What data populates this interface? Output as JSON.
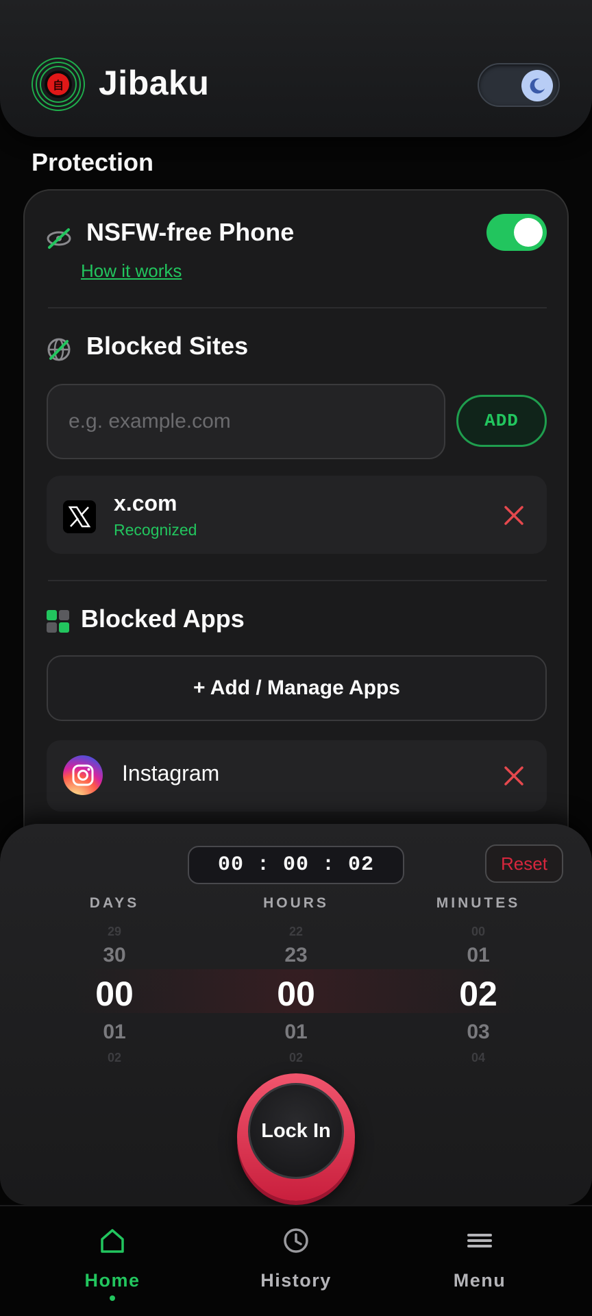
{
  "header": {
    "app_title": "Jibaku",
    "logo_glyph": "自",
    "theme_toggle_state": "dark"
  },
  "protection": {
    "section_title": "Protection",
    "nsfw": {
      "title": "NSFW-free Phone",
      "enabled": true,
      "how_link": "How it works"
    },
    "blocked_sites": {
      "title": "Blocked Sites",
      "input_placeholder": "e.g. example.com",
      "input_value": "",
      "add_label": "ADD",
      "items": [
        {
          "name": "x.com",
          "status": "Recognized",
          "icon": "x-logo-icon"
        }
      ]
    },
    "blocked_apps": {
      "title": "Blocked Apps",
      "manage_label": "+ Add / Manage Apps",
      "items": [
        {
          "name": "Instagram",
          "icon": "instagram-logo-icon"
        }
      ]
    }
  },
  "timer": {
    "display": "00 : 00 : 02",
    "reset_label": "Reset",
    "columns": [
      {
        "label": "DAYS",
        "far_prev": "29",
        "prev": "30",
        "selected": "00",
        "next": "01",
        "far_next": "02"
      },
      {
        "label": "HOURS",
        "far_prev": "22",
        "prev": "23",
        "selected": "00",
        "next": "01",
        "far_next": "02"
      },
      {
        "label": "MINUTES",
        "far_prev": "00",
        "prev": "01",
        "selected": "02",
        "next": "03",
        "far_next": "04"
      }
    ],
    "lock_label": "Lock In"
  },
  "nav": {
    "items": [
      {
        "label": "Home",
        "icon": "home-icon",
        "active": true
      },
      {
        "label": "History",
        "icon": "clock-icon",
        "active": false
      },
      {
        "label": "Menu",
        "icon": "menu-icon",
        "active": false
      }
    ]
  },
  "colors": {
    "accent_green": "#22c55e",
    "danger_red": "#e5484d",
    "lock_pink": "#e8415e",
    "background": "#060606"
  }
}
